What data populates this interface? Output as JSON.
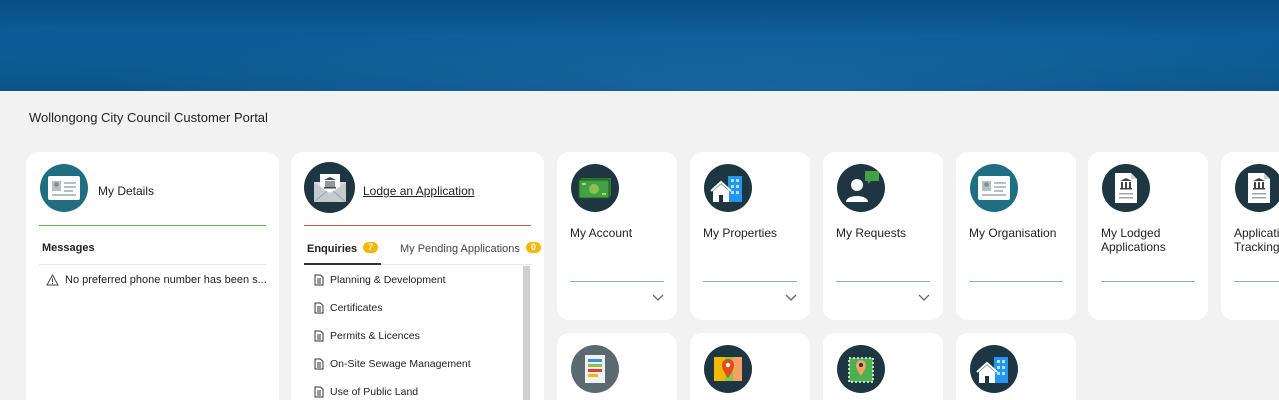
{
  "portal": {
    "title": "Wollongong City Council Customer Portal"
  },
  "details": {
    "title": "My Details",
    "icon": "id-card-icon",
    "messages_heading": "Messages",
    "message": "No preferred phone number has been s..."
  },
  "lodge": {
    "title": "Lodge an Application",
    "icon": "envelope-building-icon",
    "tabs": [
      {
        "label": "Enquiries",
        "count": "7"
      },
      {
        "label": "My Pending Applications",
        "count": "0"
      }
    ],
    "items": [
      "Planning & Development",
      "Certificates",
      "Permits & Licences",
      "On-Site Sewage Management",
      "Use of Public Land"
    ]
  },
  "tiles": [
    {
      "label": "My Account",
      "icon": "money-icon",
      "expandable": true
    },
    {
      "label": "My Properties",
      "icon": "house-building-icon",
      "expandable": true
    },
    {
      "label": "My Requests",
      "icon": "person-chat-icon",
      "expandable": true
    },
    {
      "label": "My Organisation",
      "icon": "id-card-icon",
      "expandable": false
    },
    {
      "label": "My Lodged Applications",
      "icon": "document-building-icon",
      "expandable": false
    },
    {
      "label": "Applications Tracking",
      "icon": "document-building-icon",
      "expandable": false
    }
  ],
  "colors": {
    "accent_dark": "#1d3641",
    "teal": "#1f6e82",
    "green_line": "#5cb85c",
    "red_line": "#d9534f",
    "badge": "#f5b800"
  }
}
